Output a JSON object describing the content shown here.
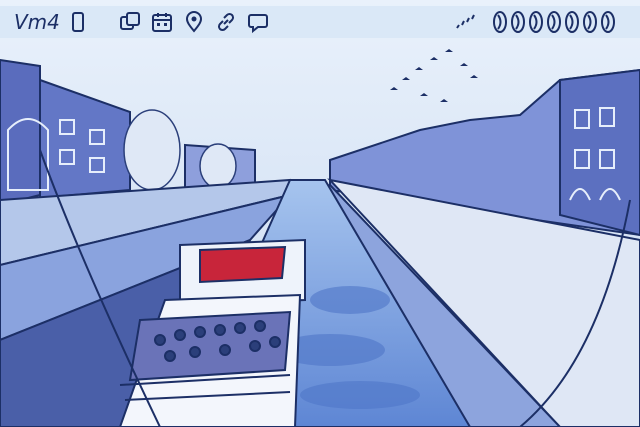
{
  "app": {
    "brand_label": "Vm4"
  },
  "toolbar": {
    "icons": [
      "phone-icon",
      "layers-icon",
      "calendar-icon",
      "location-pin-icon",
      "link-icon",
      "chat-bubble-icon"
    ]
  },
  "status": {
    "icons": [
      "signal-birds-icon",
      "swirl-icon"
    ],
    "swirl_count": 7
  },
  "colors": {
    "ink": "#1c2f66",
    "sky": "#d4e3f5",
    "water": "#6f9be0",
    "boat_roof": "#c8253a",
    "bar_bg": "#d6e5f6"
  }
}
